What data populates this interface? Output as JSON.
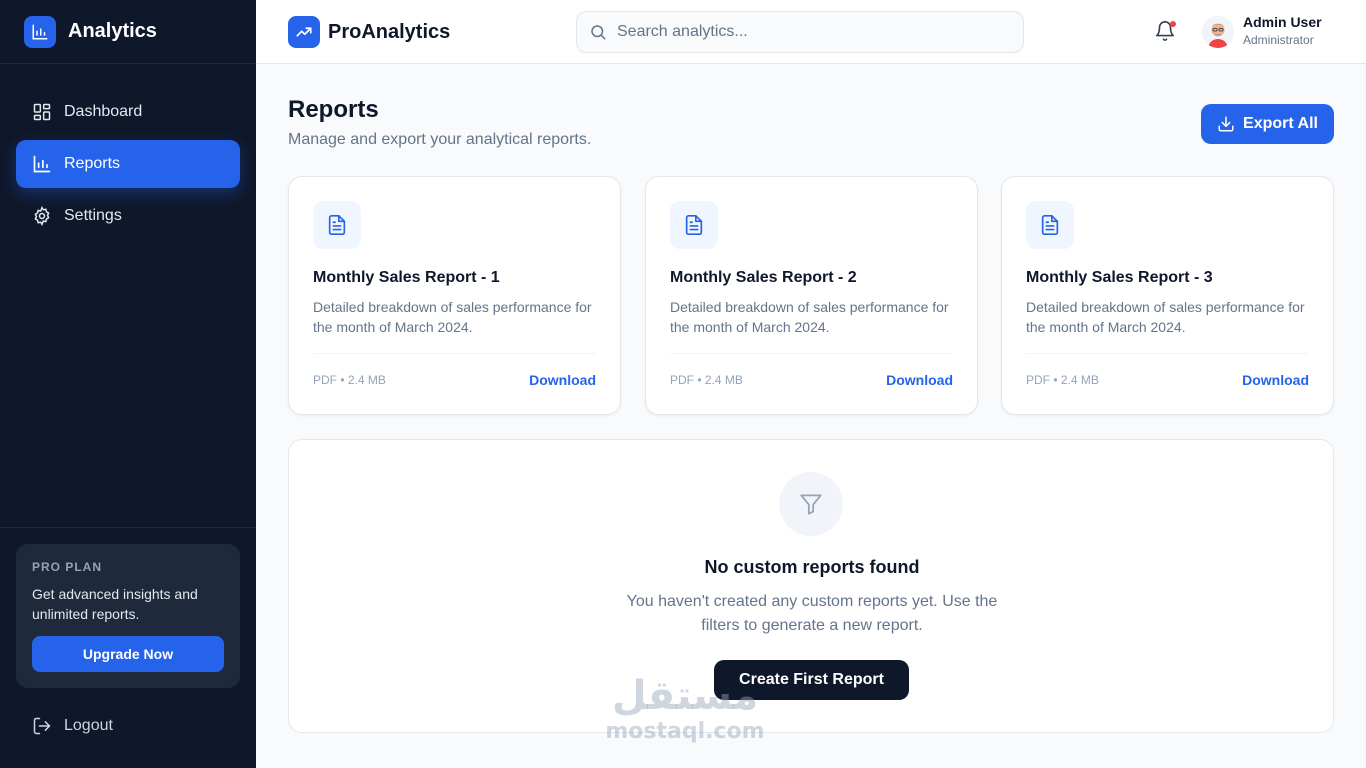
{
  "sidebar": {
    "brand": "Analytics",
    "items": [
      {
        "label": "Dashboard",
        "icon": "dashboard-icon"
      },
      {
        "label": "Reports",
        "icon": "bar-chart-icon",
        "active": true
      },
      {
        "label": "Settings",
        "icon": "gear-icon"
      }
    ],
    "pro": {
      "label": "PRO PLAN",
      "text": "Get advanced insights and unlimited reports.",
      "button": "Upgrade Now"
    },
    "logout": "Logout"
  },
  "header": {
    "brand": "ProAnalytics",
    "search_placeholder": "Search analytics...",
    "user_name": "Admin User",
    "user_role": "Administrator"
  },
  "page": {
    "title": "Reports",
    "subtitle": "Manage and export your analytical reports.",
    "export_label": "Export All"
  },
  "cards": [
    {
      "title": "Monthly Sales Report - 1",
      "desc": "Detailed breakdown of sales performance for the month of March 2024.",
      "meta": "PDF • 2.4 MB",
      "action": "Download"
    },
    {
      "title": "Monthly Sales Report - 2",
      "desc": "Detailed breakdown of sales performance for the month of March 2024.",
      "meta": "PDF • 2.4 MB",
      "action": "Download"
    },
    {
      "title": "Monthly Sales Report - 3",
      "desc": "Detailed breakdown of sales performance for the month of March 2024.",
      "meta": "PDF • 2.4 MB",
      "action": "Download"
    }
  ],
  "empty": {
    "title": "No custom reports found",
    "desc": "You haven't created any custom reports yet. Use the filters to generate a new report.",
    "button": "Create First Report"
  },
  "watermark": {
    "arabic": "مستقل",
    "latin": "mostaql.com"
  },
  "colors": {
    "accent": "#2563eb",
    "sidebar_bg": "#0f172a",
    "notification": "#ef4444"
  }
}
